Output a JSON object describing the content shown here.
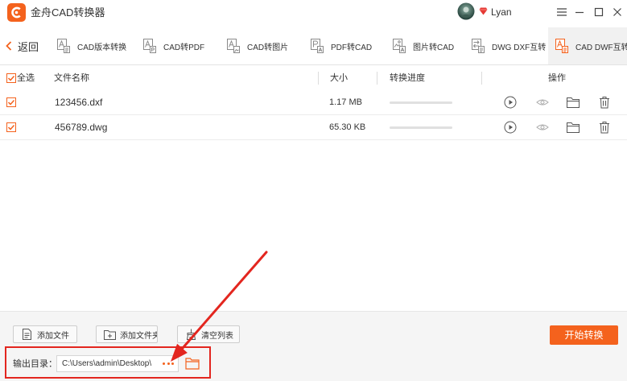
{
  "app": {
    "title": "金舟CAD转换器",
    "user_name": "Lyan"
  },
  "toolbar": {
    "back_label": "返回",
    "tabs": [
      {
        "label": "CAD版本转换",
        "icon": "cad-version-icon",
        "active": false
      },
      {
        "label": "CAD转PDF",
        "icon": "cad-to-pdf-icon",
        "active": false
      },
      {
        "label": "CAD转图片",
        "icon": "cad-to-image-icon",
        "active": false
      },
      {
        "label": "PDF转CAD",
        "icon": "pdf-to-cad-icon",
        "active": false
      },
      {
        "label": "图片转CAD",
        "icon": "image-to-cad-icon",
        "active": false
      },
      {
        "label": "DWG DXF互转",
        "icon": "dwg-dxf-convert-icon",
        "active": false
      },
      {
        "label": "CAD DWF互转",
        "icon": "cad-dwf-convert-icon",
        "active": true
      }
    ]
  },
  "table": {
    "select_all_label": "全选",
    "select_all_checked": true,
    "columns": {
      "name": "文件名称",
      "size": "大小",
      "progress": "转换进度",
      "actions": "操作"
    },
    "rows": [
      {
        "checked": true,
        "name": "123456.dxf",
        "size": "1.17 MB",
        "progress": 0
      },
      {
        "checked": true,
        "name": "456789.dwg",
        "size": "65.30 KB",
        "progress": 0
      }
    ],
    "row_action_icons": [
      "play-icon",
      "eye-icon",
      "folder-icon",
      "trash-icon"
    ]
  },
  "footer": {
    "add_file_label": "添加文件",
    "add_folder_label": "添加文件夹",
    "clear_list_label": "清空列表",
    "start_label": "开始转换",
    "output_dir_label": "输出目录：",
    "output_dir_path": "C:\\Users\\admin\\Desktop\\"
  },
  "colors": {
    "accent": "#f4621d",
    "annotation": "#e3261f"
  }
}
